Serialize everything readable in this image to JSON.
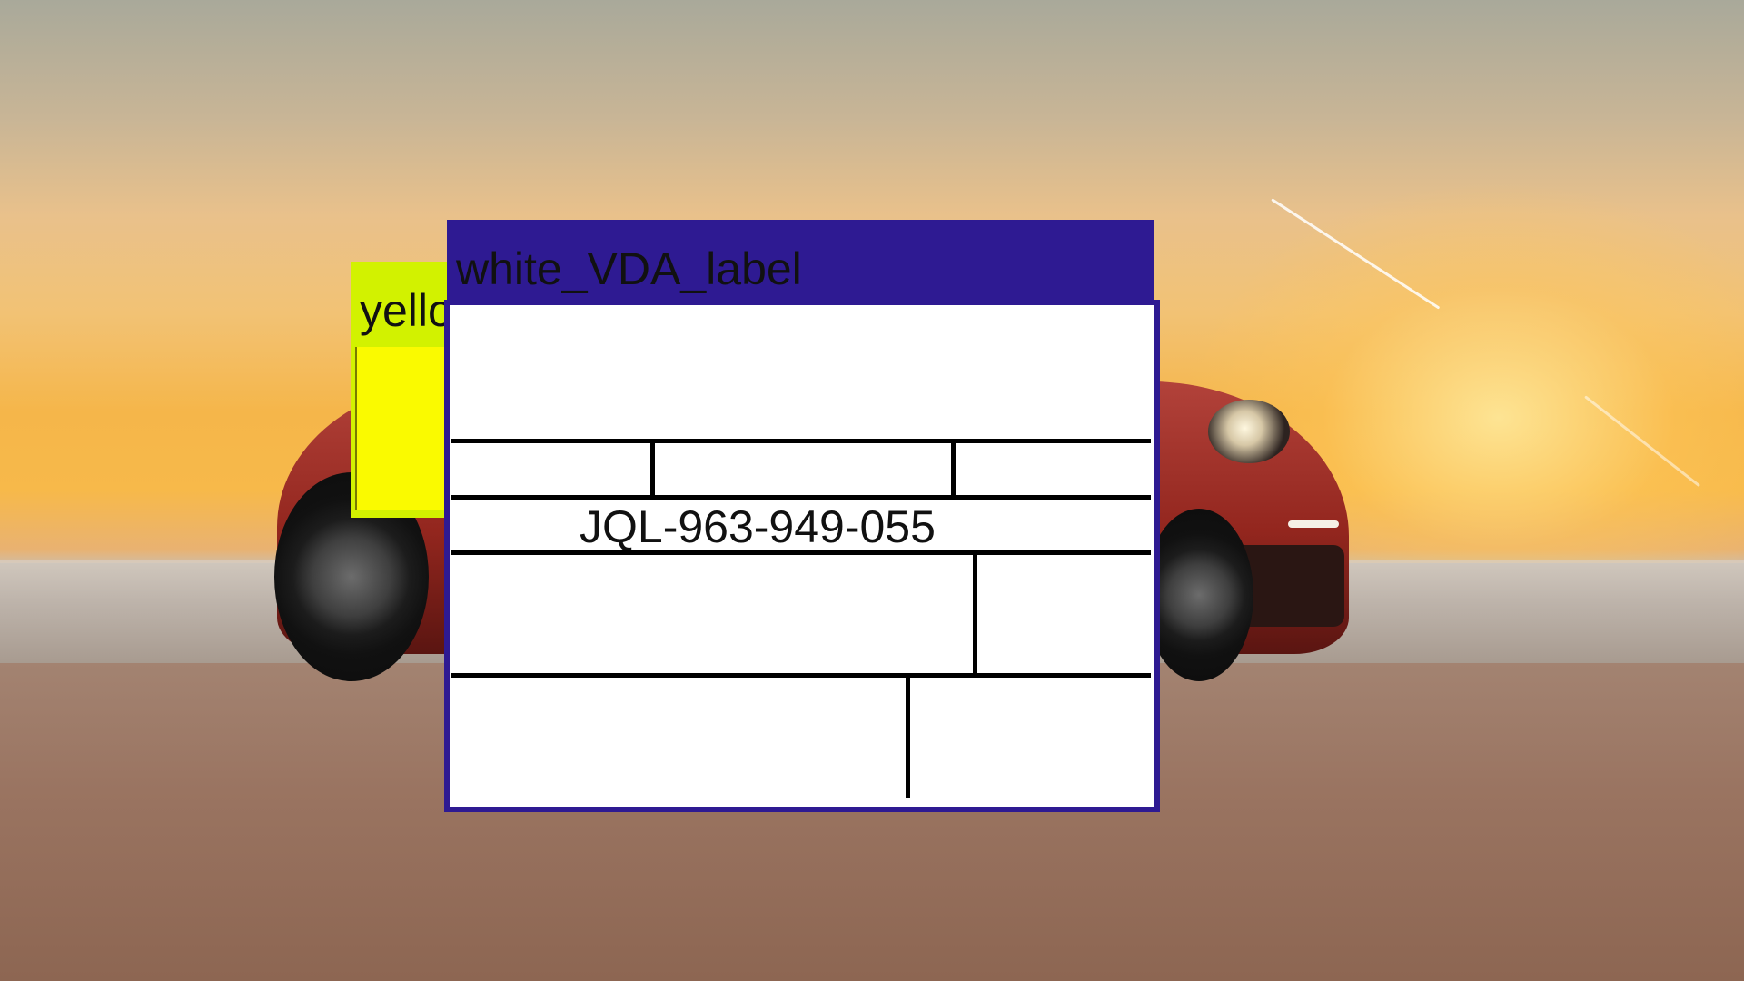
{
  "labels": {
    "vda_title": "white_VDA_label",
    "yellow_title": "yellow_VDA_label",
    "code": "JQL-963-949-055"
  },
  "colors": {
    "vda_header": "#2e1a92",
    "yellow_label": "#d2f200",
    "yellow_inner": "#fafa00"
  }
}
